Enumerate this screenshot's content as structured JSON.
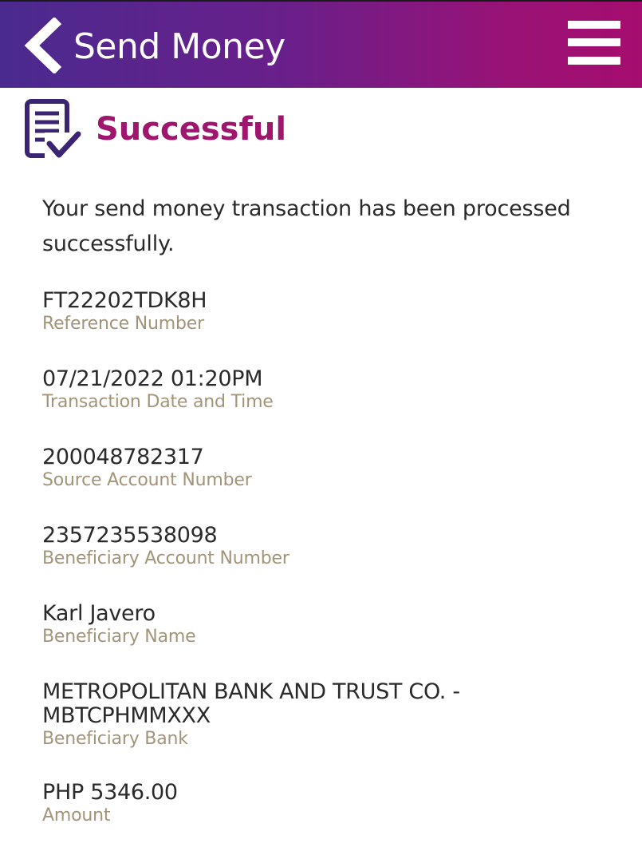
{
  "header": {
    "title": "Send Money",
    "back_icon": "chevron-left-icon",
    "menu_icon": "hamburger-menu-icon"
  },
  "status": {
    "icon": "document-check-icon",
    "title": "Successful",
    "message": "Your send money transaction has been processed successfully."
  },
  "details": [
    {
      "value": "FT22202TDK8H",
      "label": "Reference Number"
    },
    {
      "value": "07/21/2022 01:20PM",
      "label": "Transaction Date and Time"
    },
    {
      "value": "200048782317",
      "label": "Source Account Number"
    },
    {
      "value": "2357235538098",
      "label": "Beneficiary Account Number"
    },
    {
      "value": "Karl Javero",
      "label": "Beneficiary Name"
    },
    {
      "value": "METROPOLITAN BANK AND TRUST CO. - MBTCPHMMXXX",
      "label": "Beneficiary Bank"
    },
    {
      "value": "PHP 5346.00",
      "label": "Amount"
    }
  ],
  "colors": {
    "header_start": "#4a2a8f",
    "header_end": "#a50d6e",
    "accent": "#a0166f",
    "icon": "#3b2472",
    "label": "#a39478",
    "text": "#2a2a2a"
  }
}
